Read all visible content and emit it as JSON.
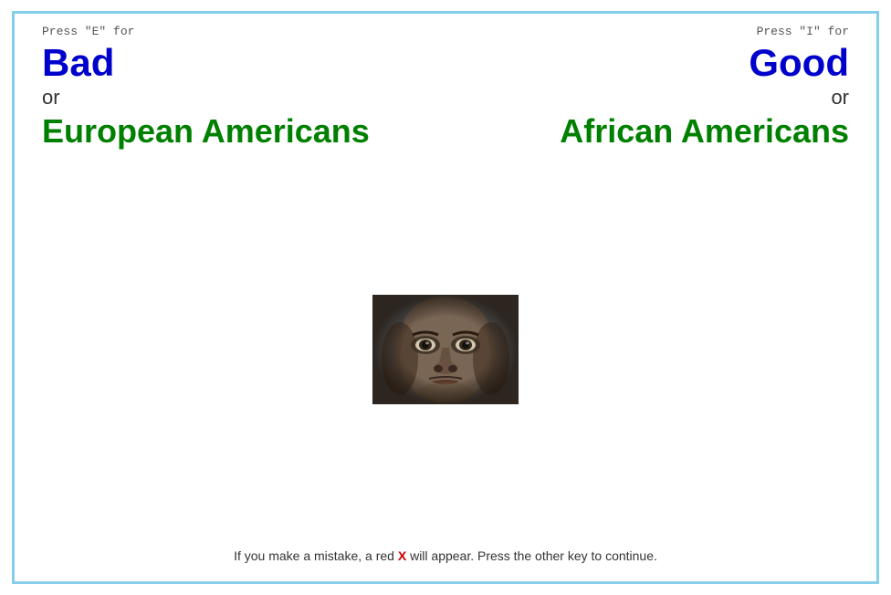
{
  "border_color": "#87CEEB",
  "left": {
    "press_label": "Press \"E\" for",
    "good_bad": "Bad",
    "or": "or",
    "group": "European Americans"
  },
  "right": {
    "press_label": "Press \"I\" for",
    "good_bad": "Good",
    "or": "or",
    "group": "African Americans"
  },
  "bottom": {
    "text_before_x": "If you make a mistake, a red ",
    "x_label": "X",
    "text_after_x": " will appear. Press the other key to continue."
  }
}
